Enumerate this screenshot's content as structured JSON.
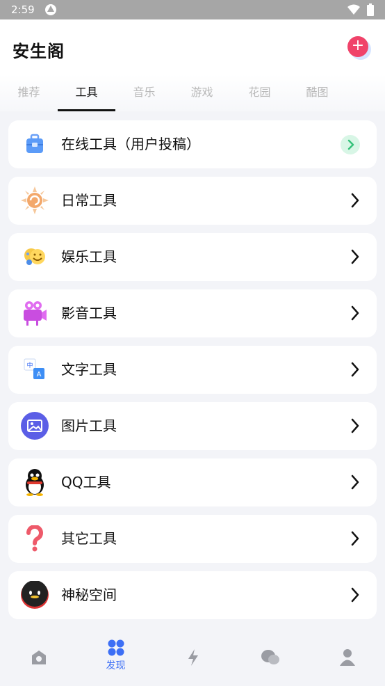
{
  "status_bar": {
    "time": "2:59"
  },
  "header": {
    "title": "安生阁",
    "add_icon": "plus-icon"
  },
  "tabs": [
    {
      "label": "推荐",
      "active": false
    },
    {
      "label": "工具",
      "active": true
    },
    {
      "label": "音乐",
      "active": false
    },
    {
      "label": "游戏",
      "active": false
    },
    {
      "label": "花园",
      "active": false
    },
    {
      "label": "酷图",
      "active": false
    }
  ],
  "tools": [
    {
      "label": "在线工具（用户投稿）",
      "icon": "toolbox-icon"
    },
    {
      "label": "日常工具",
      "icon": "sun-icon"
    },
    {
      "label": "娱乐工具",
      "icon": "faces-icon"
    },
    {
      "label": "影音工具",
      "icon": "video-camera-icon"
    },
    {
      "label": "文字工具",
      "icon": "translate-icon"
    },
    {
      "label": "图片工具",
      "icon": "image-icon"
    },
    {
      "label": "QQ工具",
      "icon": "qq-penguin-icon"
    },
    {
      "label": "其它工具",
      "icon": "question-icon"
    },
    {
      "label": "神秘空间",
      "icon": "mystery-face-icon"
    }
  ],
  "bottom_nav": [
    {
      "label": "",
      "icon": "home-icon"
    },
    {
      "label": "发现",
      "icon": "discover-grid-icon",
      "active": true
    },
    {
      "label": "",
      "icon": "lightning-icon"
    },
    {
      "label": "",
      "icon": "chat-bubbles-icon"
    },
    {
      "label": "",
      "icon": "profile-icon"
    }
  ],
  "colors": {
    "accent": "#3d6ff5",
    "add_button": "#f0436a",
    "chevron_green": "#35c27a"
  }
}
